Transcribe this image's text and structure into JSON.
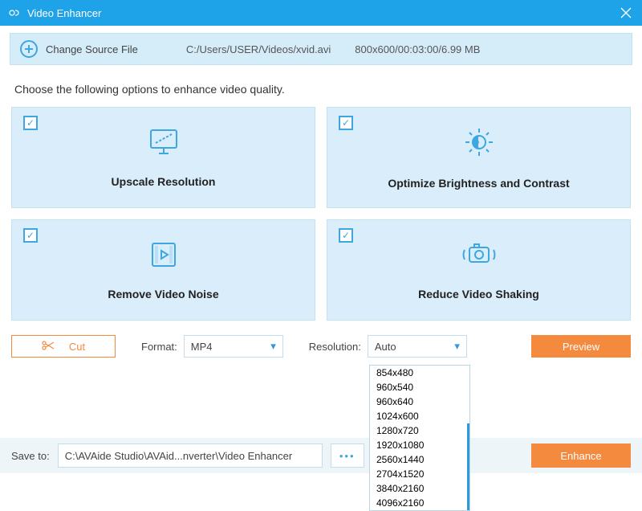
{
  "titlebar": {
    "title": "Video Enhancer"
  },
  "sourcebar": {
    "change_label": "Change Source File",
    "path": "C:/Users/USER/Videos/xvid.avi",
    "info": "800x600/00:03:00/6.99 MB"
  },
  "instruction": "Choose the following options to enhance video quality.",
  "cards": {
    "upscale": "Upscale Resolution",
    "brightness": "Optimize Brightness and Contrast",
    "noise": "Remove Video Noise",
    "shaking": "Reduce Video Shaking"
  },
  "controls": {
    "cut": "Cut",
    "format_label": "Format:",
    "format_value": "MP4",
    "resolution_label": "Resolution:",
    "resolution_value": "Auto",
    "preview": "Preview"
  },
  "dropdown": {
    "items": [
      "854x480",
      "960x540",
      "960x640",
      "1024x600",
      "1280x720",
      "1920x1080",
      "2560x1440",
      "2704x1520",
      "3840x2160",
      "4096x2160"
    ]
  },
  "savebar": {
    "label": "Save to:",
    "path": "C:\\AVAide Studio\\AVAid...nverter\\Video Enhancer",
    "enhance": "Enhance"
  }
}
